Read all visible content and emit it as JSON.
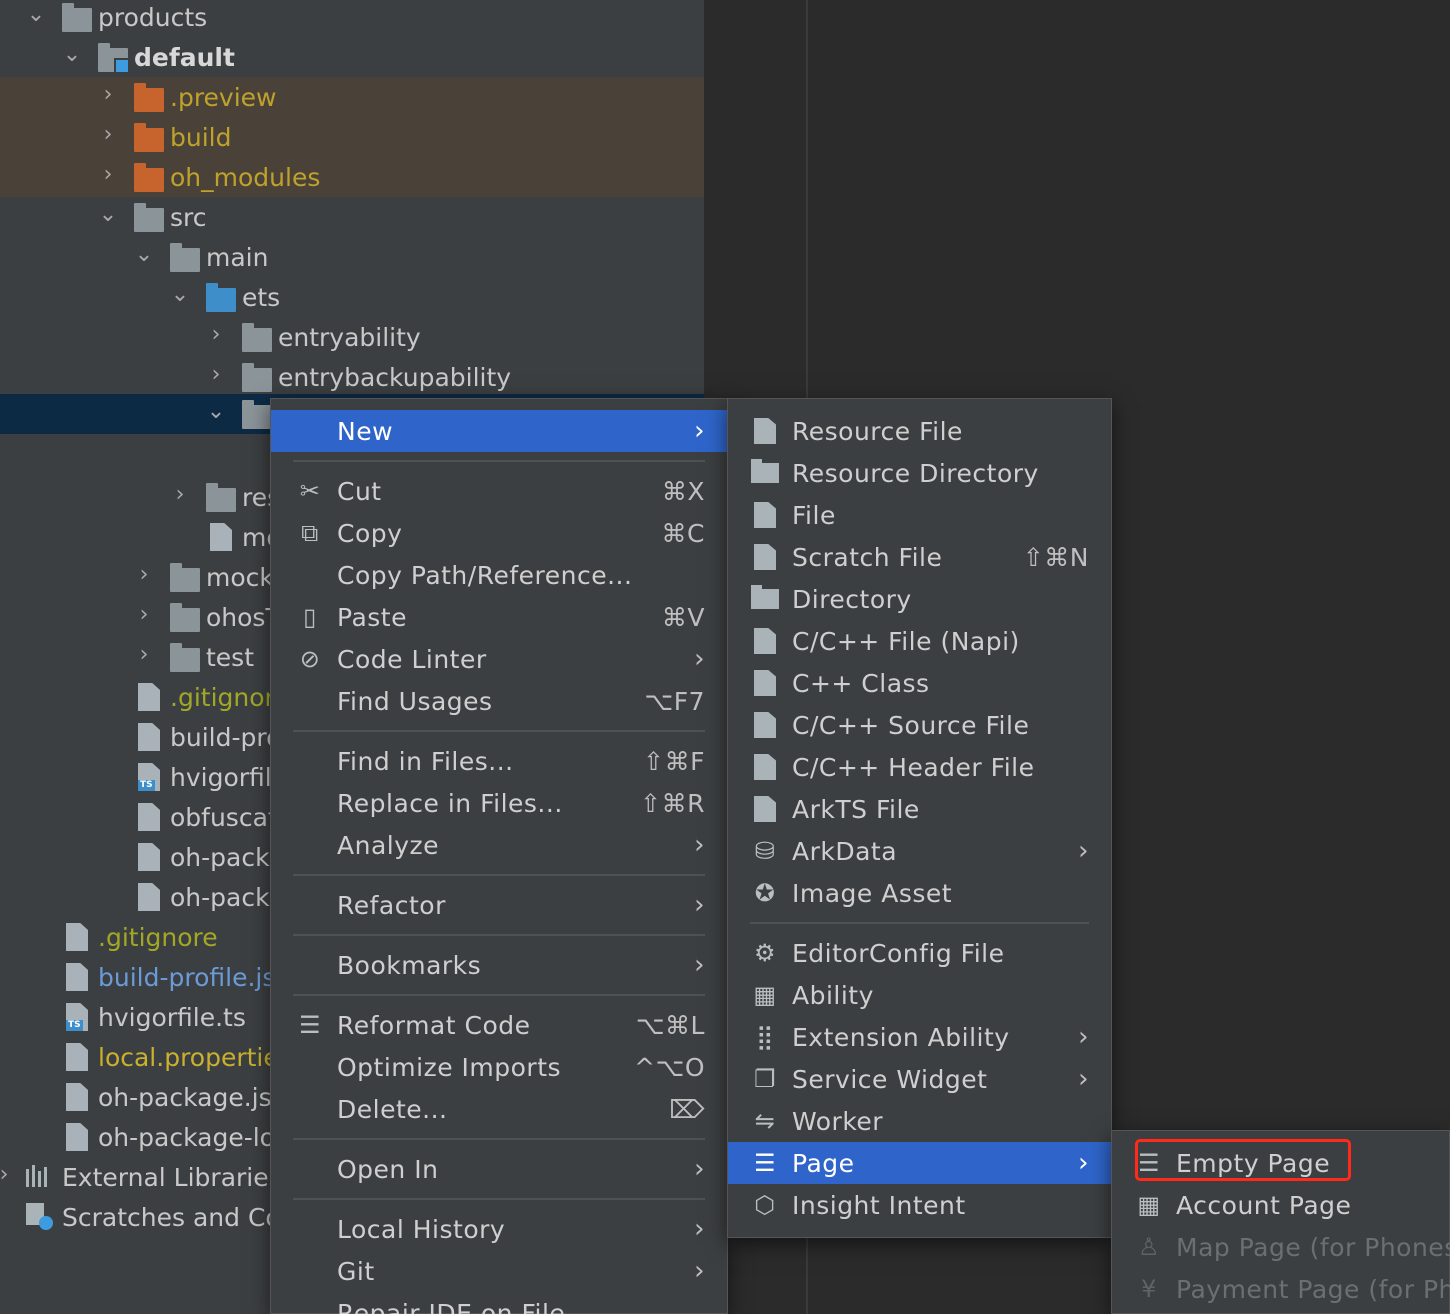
{
  "tree": {
    "rows": [
      {
        "label": "products"
      },
      {
        "label": "default"
      },
      {
        "label": ".preview"
      },
      {
        "label": "build"
      },
      {
        "label": "oh_modules"
      },
      {
        "label": "src"
      },
      {
        "label": "main"
      },
      {
        "label": "ets"
      },
      {
        "label": "entryability"
      },
      {
        "label": "entrybackupability"
      },
      {
        "label": ""
      },
      {
        "label": "res"
      },
      {
        "label": "mo"
      },
      {
        "label": "mock"
      },
      {
        "label": "ohosT"
      },
      {
        "label": "test"
      },
      {
        "label": ".gitignore"
      },
      {
        "label": "build-pro"
      },
      {
        "label": "hvigorfile"
      },
      {
        "label": "obfuscat"
      },
      {
        "label": "oh-packa"
      },
      {
        "label": "oh-packa"
      },
      {
        "label": ".gitignore"
      },
      {
        "label": "build-profile.jsc"
      },
      {
        "label": "hvigorfile.ts"
      },
      {
        "label": "local.propertie"
      },
      {
        "label": "oh-package.jsc"
      },
      {
        "label": "oh-package-lo"
      },
      {
        "label": "External Libraries"
      },
      {
        "label": "Scratches and Co"
      }
    ]
  },
  "context_menu": {
    "items": [
      {
        "label": "New",
        "shortcut": ""
      },
      {
        "label": "Cut",
        "shortcut": "⌘X"
      },
      {
        "label": "Copy",
        "shortcut": "⌘C"
      },
      {
        "label": "Copy Path/Reference...",
        "shortcut": ""
      },
      {
        "label": "Paste",
        "shortcut": "⌘V"
      },
      {
        "label": "Code Linter",
        "shortcut": ""
      },
      {
        "label": "Find Usages",
        "shortcut": "⌥F7"
      },
      {
        "label": "Find in Files...",
        "shortcut": "⇧⌘F"
      },
      {
        "label": "Replace in Files...",
        "shortcut": "⇧⌘R"
      },
      {
        "label": "Analyze",
        "shortcut": ""
      },
      {
        "label": "Refactor",
        "shortcut": ""
      },
      {
        "label": "Bookmarks",
        "shortcut": ""
      },
      {
        "label": "Reformat Code",
        "shortcut": "⌥⌘L"
      },
      {
        "label": "Optimize Imports",
        "shortcut": "^⌥O"
      },
      {
        "label": "Delete...",
        "shortcut": "⌦"
      },
      {
        "label": "Open In",
        "shortcut": ""
      },
      {
        "label": "Local History",
        "shortcut": ""
      },
      {
        "label": "Git",
        "shortcut": ""
      },
      {
        "label": "Repair IDE on File",
        "shortcut": ""
      }
    ]
  },
  "new_menu": {
    "items": [
      {
        "label": "Resource File",
        "shortcut": ""
      },
      {
        "label": "Resource Directory",
        "shortcut": ""
      },
      {
        "label": "File",
        "shortcut": ""
      },
      {
        "label": "Scratch File",
        "shortcut": "⇧⌘N"
      },
      {
        "label": "Directory",
        "shortcut": ""
      },
      {
        "label": "C/C++ File (Napi)",
        "shortcut": ""
      },
      {
        "label": "C++ Class",
        "shortcut": ""
      },
      {
        "label": "C/C++ Source File",
        "shortcut": ""
      },
      {
        "label": "C/C++ Header File",
        "shortcut": ""
      },
      {
        "label": "ArkTS File",
        "shortcut": ""
      },
      {
        "label": "ArkData",
        "shortcut": ""
      },
      {
        "label": "Image Asset",
        "shortcut": ""
      },
      {
        "label": "EditorConfig File",
        "shortcut": ""
      },
      {
        "label": "Ability",
        "shortcut": ""
      },
      {
        "label": "Extension Ability",
        "shortcut": ""
      },
      {
        "label": "Service Widget",
        "shortcut": ""
      },
      {
        "label": "Worker",
        "shortcut": ""
      },
      {
        "label": "Page",
        "shortcut": ""
      },
      {
        "label": "Insight Intent",
        "shortcut": ""
      }
    ]
  },
  "page_menu": {
    "items": [
      {
        "label": "Empty Page"
      },
      {
        "label": "Account Page"
      },
      {
        "label": "Map Page (for Phones"
      },
      {
        "label": "Payment Page (for Pho"
      }
    ]
  },
  "colors": {
    "highlight": "#2f65ca",
    "annotation": "#ff2a1a",
    "panel": "#3c3f41",
    "editor": "#2b2b2b"
  },
  "icons": {
    "chevron-right": "›",
    "chevron-down": "⌄"
  }
}
